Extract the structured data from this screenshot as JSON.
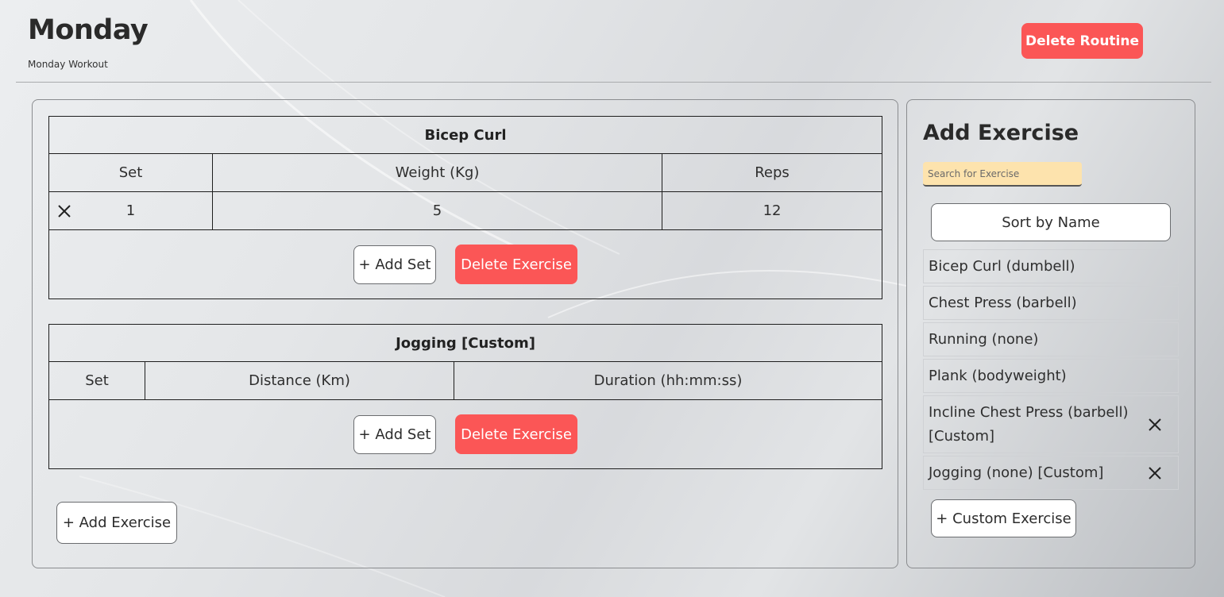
{
  "routine": {
    "title": "Monday",
    "subtitle": "Monday Workout",
    "delete_label": "Delete Routine"
  },
  "colors": {
    "accent_red": "#fb5656",
    "search_bg": "#fde3ad"
  },
  "exercises": [
    {
      "name": "Bicep Curl",
      "columns": [
        "Set",
        "Weight (Kg)",
        "Reps"
      ],
      "sets": [
        {
          "set": "1",
          "weight": "5",
          "reps": "12",
          "remove_icon": "close-icon"
        }
      ],
      "add_set_label": "+ Add Set",
      "delete_label": "Delete Exercise"
    },
    {
      "name": "Jogging [Custom]",
      "columns": [
        "Set",
        "Distance (Km)",
        "Duration (hh:mm:ss)"
      ],
      "sets": [],
      "add_set_label": "+ Add Set",
      "delete_label": "Delete Exercise"
    }
  ],
  "add_exercise_label": "+ Add Exercise",
  "sidebar": {
    "title": "Add Exercise",
    "search_placeholder": "Search for Exercise",
    "sort_label": "Sort by Name",
    "items": [
      {
        "label": "Bicep Curl (dumbell)",
        "removable": false
      },
      {
        "label": "Chest Press (barbell)",
        "removable": false
      },
      {
        "label": "Running (none)",
        "removable": false
      },
      {
        "label": "Plank (bodyweight)",
        "removable": false
      },
      {
        "label": "Incline Chest Press (barbell) [Custom]",
        "removable": true
      },
      {
        "label": "Jogging (none) [Custom]",
        "removable": true
      }
    ],
    "custom_label": "+ Custom Exercise"
  }
}
